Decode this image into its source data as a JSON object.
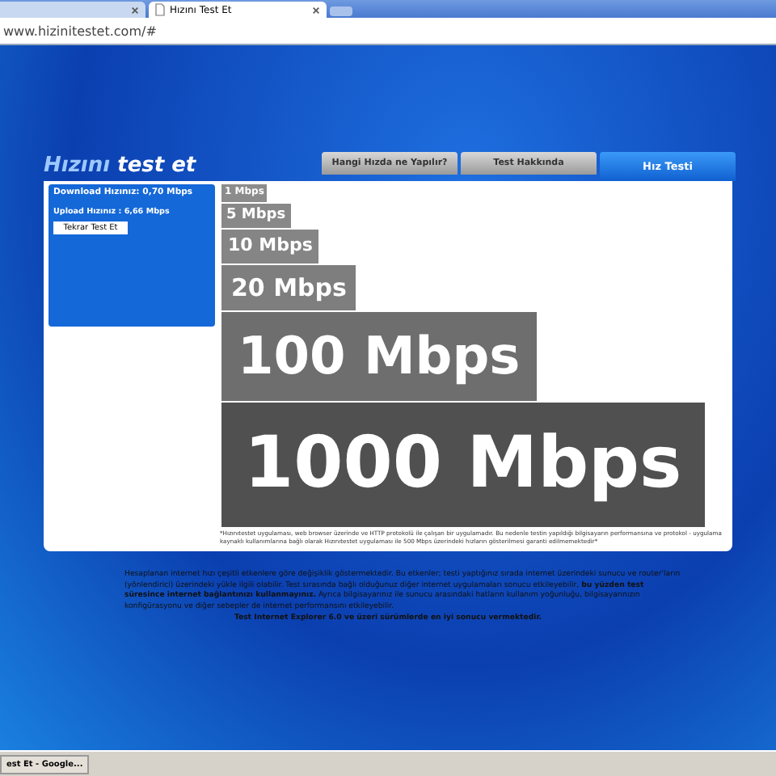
{
  "browser": {
    "tabs": [
      {
        "selected": false
      },
      {
        "title": "Hızını Test Et",
        "selected": true
      }
    ],
    "address": "www.hizinitestet.com/#"
  },
  "logo": {
    "word_1": "Hızını",
    "word_2": "test et"
  },
  "tabs": [
    {
      "label": "Hangi Hızda ne Yapılır?",
      "selected": false
    },
    {
      "label": "Test Hakkında",
      "selected": false
    },
    {
      "label": "Hız Testi",
      "selected": true
    }
  ],
  "result": {
    "download": "Download Hızınız: 0,70 Mbps",
    "upload": "Upload Hızınız : 6,66 Mbps",
    "retry_button": "Tekrar Test Et"
  },
  "speeds": [
    "1 Mbps",
    "5 Mbps",
    "10 Mbps",
    "20 Mbps",
    "100 Mbps",
    "1000 Mbps"
  ],
  "footnote": "*Hızınıtestet uygulaması, web browser üzerinde ve HTTP protokolü ile çalışan bir uygulamadır. Bu nedenle testin yapıldığı bilgisayarın performansına ve protokol - uygulama kaynaklı kullanımlarına bağlı olarak Hızınıtestet uygulaması ile 500 Mbps üzerindeki hızların gösterilmesi garanti edilmemektedir*",
  "notice": "Hesaplanan internet hızı çeşitli etkenlere göre değişiklik göstermektedir. Bu etkenler; testi yaptığınız sırada internet üzerindeki sunucu ve router'ların (yönlendirici) üzerindeki yükle ilgili olabilir. Test sırasında bağlı olduğunuz diğer internet uygulamaları sonucu etkileyebilir, **bu yüzden test süresince internet bağlantınızı kullanmayınız.** Ayrıca bilgisayarınız ile sunucu arasındaki hatların kullanım yoğunluğu, bilgisayarınızın konfigürasyonu ve diğer sebepler de internet performansını etkileyebilir.",
  "browser_note": "Test Internet Explorer 6.0 ve üzeri sürümlerde en iyi sonucu vermektedir.",
  "taskbar": {
    "button": "est Et - Google..."
  }
}
